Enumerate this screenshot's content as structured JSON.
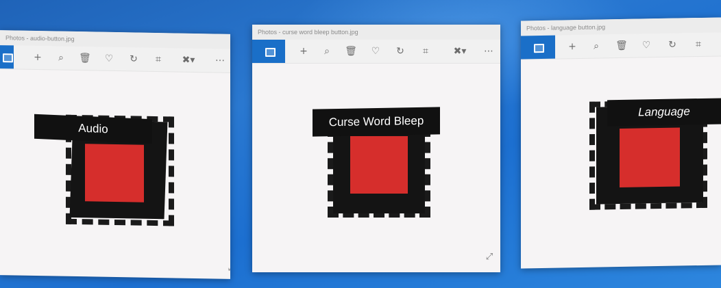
{
  "windows": [
    {
      "title": "Photos - audio-button.jpg",
      "button_label": "Audio"
    },
    {
      "title": "Photos - curse word bleep button.jpg",
      "button_label": "Curse Word Bleep"
    },
    {
      "title": "Photos - language button.jpg",
      "button_label": "Language"
    }
  ],
  "toolbar_icons": [
    "photos-app-icon",
    "add-icon",
    "zoom-icon",
    "delete-icon",
    "favorite-icon",
    "rotate-icon",
    "crop-icon",
    "edit-icon",
    "more-icon"
  ],
  "colors": {
    "desktop": "#1f63b8",
    "app_accent": "#1a6fc8",
    "button_red": "#d62e2c",
    "label_bg": "#111111"
  }
}
